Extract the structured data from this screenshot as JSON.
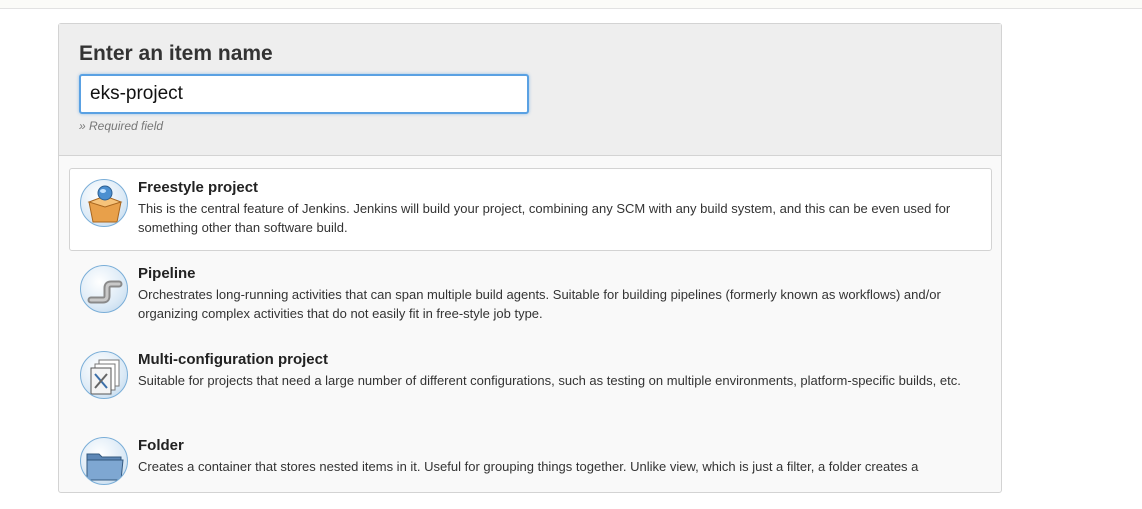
{
  "form": {
    "title": "Enter an item name",
    "item_name_value": "eks-project",
    "required_note": "» Required field"
  },
  "item_types": [
    {
      "label": "Freestyle project",
      "description": "This is the central feature of Jenkins. Jenkins will build your project, combining any SCM with any build system, and this can be even used for something other than software build.",
      "icon": "freestyle-box-icon",
      "selected": true
    },
    {
      "label": "Pipeline",
      "description": "Orchestrates long-running activities that can span multiple build agents. Suitable for building pipelines (formerly known as workflows) and/or organizing complex activities that do not easily fit in free-style job type.",
      "icon": "pipeline-icon",
      "selected": false
    },
    {
      "label": "Multi-configuration project",
      "description": "Suitable for projects that need a large number of different configurations, such as testing on multiple environments, platform-specific builds, etc.",
      "icon": "multi-configuration-icon",
      "selected": false
    },
    {
      "label": "Folder",
      "description": "Creates a container that stores nested items in it. Useful for grouping things together. Unlike view, which is just a filter, a folder creates a",
      "icon": "folder-icon",
      "selected": false
    }
  ],
  "colors": {
    "input_focus_border": "#5aa1e3",
    "header_bg": "#eeeeee",
    "panel_bg": "#f9f9f9"
  }
}
